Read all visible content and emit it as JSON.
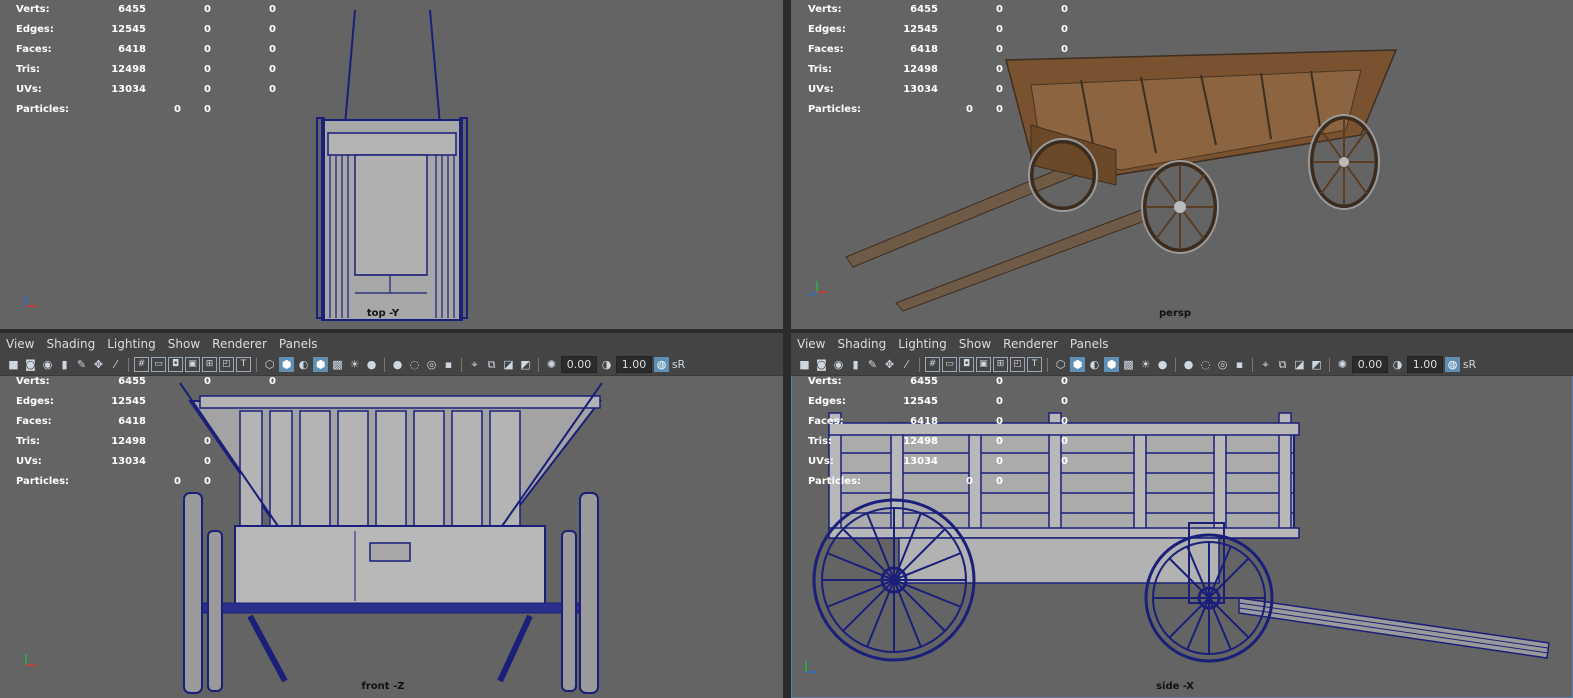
{
  "hud": {
    "labels": {
      "verts": "Verts:",
      "edges": "Edges:",
      "faces": "Faces:",
      "tris": "Tris:",
      "uvs": "UVs:",
      "particles": "Particles:"
    },
    "values": {
      "verts": [
        "6455",
        "0",
        "0"
      ],
      "edges": [
        "12545",
        "0",
        "0"
      ],
      "faces": [
        "6418",
        "0",
        "0"
      ],
      "tris": [
        "12498",
        "0",
        "0"
      ],
      "uvs": [
        "13034",
        "0",
        "0"
      ],
      "particles": [
        "0",
        "0"
      ]
    }
  },
  "viewports": {
    "top": {
      "camera": "top -Y"
    },
    "persp": {
      "camera": "persp"
    },
    "front": {
      "camera": "front -Z"
    },
    "side": {
      "camera": "side -X"
    }
  },
  "panel_menu": [
    "View",
    "Shading",
    "Lighting",
    "Show",
    "Renderer",
    "Panels"
  ],
  "toolbar": {
    "near_clip": "0.00",
    "gamma": "1.00",
    "color_space": "sR"
  },
  "axis_gizmo": {
    "x": "x",
    "y": "y",
    "z": "z"
  },
  "colors": {
    "viewport_bg": "#646464",
    "wireframe": "#1a1f7a",
    "wood": "#7a5230"
  }
}
